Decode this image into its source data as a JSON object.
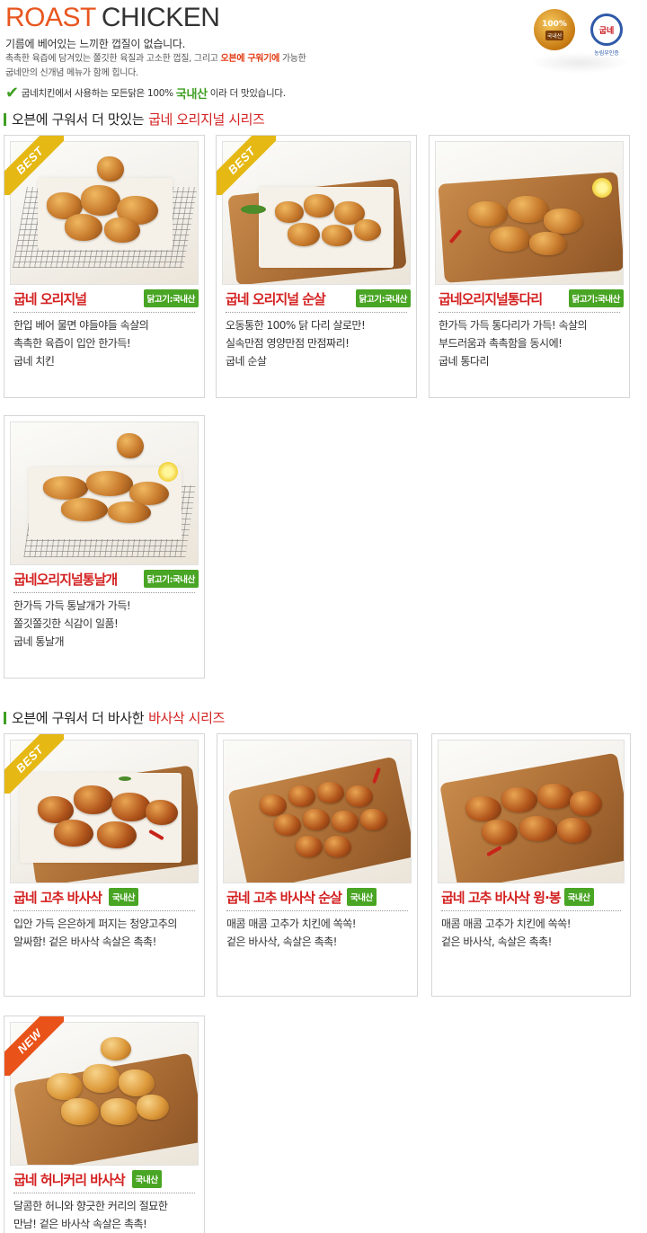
{
  "header": {
    "brand_roast": "ROAST",
    "brand_chicken": "CHICKEN",
    "subtitle": "기름에 베어있는 느끼한 껍질이 없습니다.",
    "desc_part1": "촉촉한 육즙에 담겨있는 쫄깃한 육질과 고소한 껍질, 그리고 ",
    "desc_highlight": "오븐에 구워기에",
    "desc_part2": " 가능한",
    "desc_line2": "굽네만의 신개념 메뉴가 함께 힙니다.",
    "note_part1": "굽네치킨에서 사용하는 모든닭은 100%",
    "note_highlight": "국내산",
    "note_part2": "이라 더 맛있습니다.",
    "badge_left_pct": "100%",
    "badge_left_label": "국내산",
    "badge_right_text": "굽네",
    "badge_right_caption": "농림부인증"
  },
  "section1": {
    "title_plain": "오븐에 구워서 더 맛있는",
    "title_highlight": "굽네 오리지널 시리즈"
  },
  "section2": {
    "title_plain": "오븐에 구워서 더 바사한",
    "title_highlight": "바사삭 시리즈"
  },
  "products": [
    {
      "name": "굽네 오리지널",
      "tag": "닭고기:국내산",
      "ribbon": "BEST",
      "lines": [
        "한입 베어 물면 야들야들 속살의",
        "촉촉한 육즙이 입안 한가득!",
        "굽네 치킨"
      ]
    },
    {
      "name": "굽네 오리지널 순살",
      "tag": "닭고기:국내산",
      "ribbon": "BEST",
      "lines": [
        "오동통한 100% 닭 다리 살로만!",
        "실속만점 영양만점 만점짜리!",
        "굽네 순살"
      ]
    },
    {
      "name": "굽네오리지널통다리",
      "tag": "닭고기:국내산",
      "ribbon": "",
      "lines": [
        "한가득 가득 통다리가 가득! 속살의",
        "부드러움과 촉촉함을 동시에!",
        "굽네 통다리"
      ]
    },
    {
      "name": "굽네오리지널통날개",
      "tag": "닭고기:국내산",
      "ribbon": "",
      "lines": [
        "한가득 가득 통날개가 가득!",
        "쫄깃쫄깃한 식감이 일품!",
        "굽네 통날개"
      ]
    },
    {
      "name": "굽네 고추 바사삭",
      "tag": "국내산",
      "ribbon": "BEST",
      "lines": [
        "입안 가득 은은하게 퍼지는 청양고추의",
        "알싸함! 겉은 바사삭 속살은 촉촉!"
      ]
    },
    {
      "name": "굽네 고추 바사삭 순살",
      "tag": "국내산",
      "ribbon": "",
      "lines": [
        "매콤 매콤 고추가 치킨에 쏙쏙!",
        "겉은 바사삭, 속살은 촉촉!"
      ]
    },
    {
      "name": "굽네 고추 바사삭 윙·봉",
      "tag": "국내산",
      "ribbon": "",
      "lines": [
        "매콤 매콤 고추가 치킨에 쏙쏙!",
        "겉은 바사삭, 속살은 촉촉!"
      ]
    },
    {
      "name": "굽네 허니커리 바사삭",
      "tag": "국내산",
      "ribbon": "NEW",
      "lines": [
        "달콤한 허니와 향긋한 커리의 절묘한",
        "만남! 겉은 바사삭 속살은 촉촉!"
      ]
    }
  ],
  "colors": {
    "accent_red": "#d31f1f",
    "brand_orange": "#e8561f",
    "tag_green": "#49a524",
    "best_ribbon": "#e5b814",
    "new_ribbon": "#e9531a"
  }
}
